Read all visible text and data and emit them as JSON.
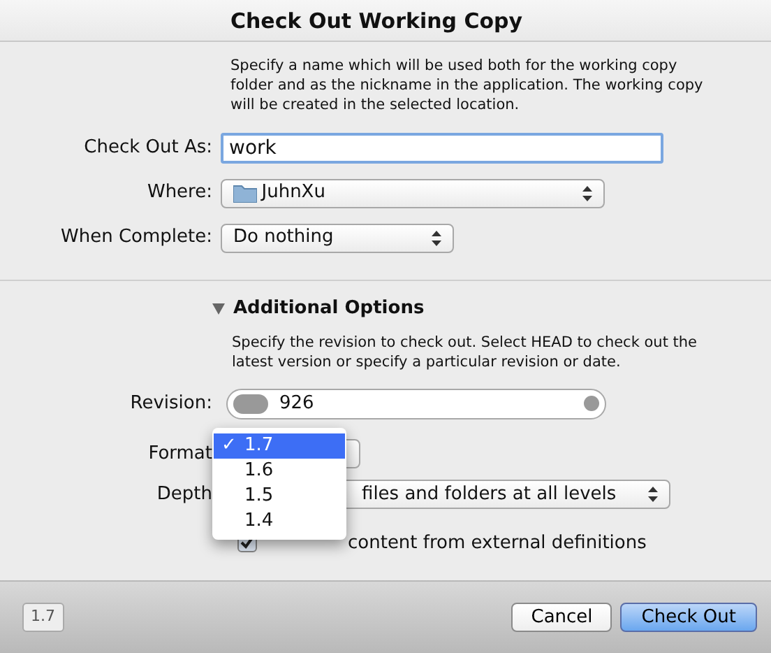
{
  "sheet": {
    "title": "Check Out Working Copy",
    "description": "Specify a name which will be used both for the working copy folder and as the nickname in the application. The working copy will be created in the selected location."
  },
  "fields": [
    {
      "label": "Check Out As:",
      "kind": "text",
      "value": "work"
    },
    {
      "label": "Where:",
      "kind": "folder",
      "value": "JuhnXu"
    },
    {
      "label": "When Complete:",
      "kind": "popup",
      "value": "Do nothing"
    }
  ],
  "additional_options": {
    "title": "Additional Options",
    "expanded": true,
    "description": "Specify the revision to check out. Select HEAD to check out the latest version or specify a particular revision or date.",
    "revision": {
      "label": "Revision:",
      "value": "926"
    },
    "format": {
      "label": "Format"
    },
    "depth": {
      "label": "Depth",
      "value": "files and folders at all levels"
    },
    "external": {
      "label": "content from external definitions",
      "checked": true
    }
  },
  "format_menu": [
    {
      "label": "1.7",
      "selected": true
    },
    {
      "label": "1.6",
      "selected": false
    },
    {
      "label": "1.5",
      "selected": false
    },
    {
      "label": "1.4",
      "selected": false
    }
  ],
  "check_mark": "✓",
  "footer": {
    "version": "1.7",
    "buttons": [
      {
        "label": "Cancel",
        "primary": false
      },
      {
        "label": "Check Out",
        "primary": true
      }
    ]
  }
}
